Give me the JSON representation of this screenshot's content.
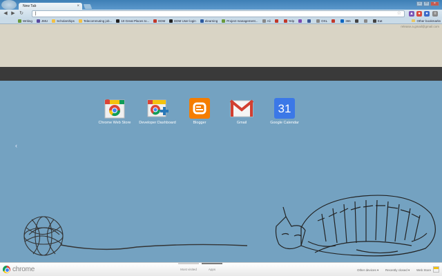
{
  "browser": {
    "tab_title": "New Tab",
    "tab_close": "×",
    "window_buttons": [
      "–",
      "□",
      "×"
    ],
    "address_value": "",
    "nav": {
      "back": "◀",
      "forward": "▶",
      "reload": "↻"
    }
  },
  "bookmarks": {
    "items": [
      {
        "label": "Writing",
        "color": "#6b9a3c"
      },
      {
        "label": "JMU",
        "color": "#5a4aa0"
      },
      {
        "label": "Scholarships",
        "color": "#f2c045"
      },
      {
        "label": "Telecommuting job...",
        "color": "#f2c045"
      },
      {
        "label": "10 Great Places to...",
        "color": "#222222"
      },
      {
        "label": "EDM",
        "color": "#c0392b"
      },
      {
        "label": "EDM User login",
        "color": "#222222"
      },
      {
        "label": "elearning",
        "color": "#2c5aa0"
      },
      {
        "label": "Project management...",
        "color": "#6b9a3c"
      },
      {
        "label": "Ali",
        "color": "#888888"
      },
      {
        "label": "",
        "color": "#c0392b"
      },
      {
        "label": "Yelp",
        "color": "#c0392b"
      },
      {
        "label": "",
        "color": "#7b4bb0"
      },
      {
        "label": "",
        "color": "#3b5998"
      },
      {
        "label": "OXL",
        "color": "#888888"
      },
      {
        "label": "",
        "color": "#c0392b"
      },
      {
        "label": "365",
        "color": "#0a66c2"
      },
      {
        "label": "",
        "color": "#444444"
      },
      {
        "label": "",
        "color": "#888888"
      },
      {
        "label": "Eat",
        "color": "#444444"
      }
    ],
    "other": "Other bookmarks"
  },
  "ntp": {
    "signed_in": "release.a.gmail@gmail.com",
    "page_prev": "‹"
  },
  "apps": [
    {
      "label": "Chrome Web Store"
    },
    {
      "label": "Developer Dashboard"
    },
    {
      "label": "Blogger"
    },
    {
      "label": "Gmail"
    },
    {
      "label": "Google Calendar",
      "calendar_day": "31"
    }
  ],
  "footer": {
    "brand": "chrome",
    "tabs": [
      "Most visited",
      "Apps"
    ],
    "other_devices": "Other devices",
    "recently_closed": "Recently closed",
    "web_store": "Web Store"
  },
  "colors": {
    "background": "#74a2c1",
    "band": "#d9d4c5",
    "dark_bar": "#3a3a3a",
    "blogger": "#f57d00",
    "calendar": "#3b78e7"
  }
}
